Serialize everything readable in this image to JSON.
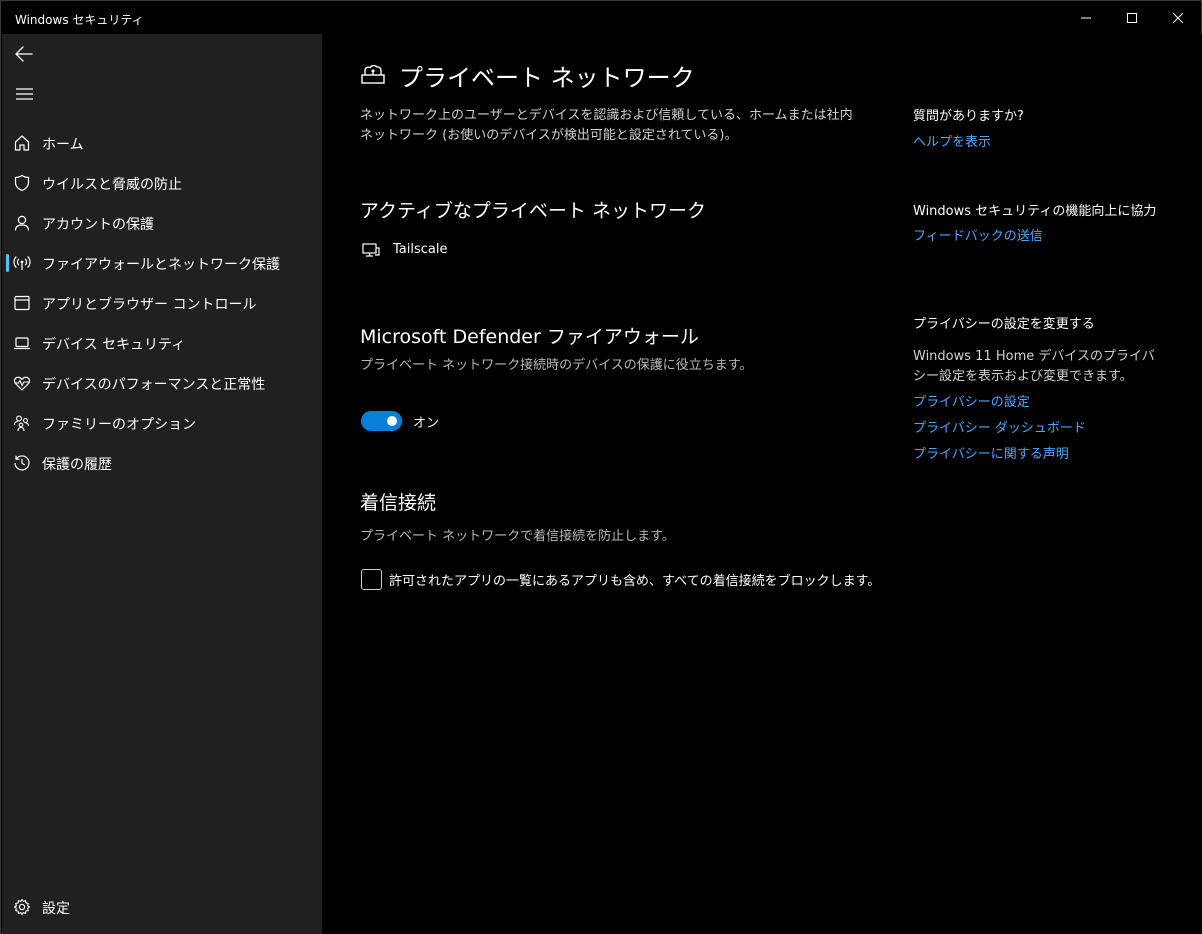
{
  "window": {
    "title": "Windows セキュリティ"
  },
  "sidebar": {
    "items": [
      {
        "label": "ホーム",
        "icon": "home-icon"
      },
      {
        "label": "ウイルスと脅威の防止",
        "icon": "shield-icon"
      },
      {
        "label": "アカウントの保護",
        "icon": "person-icon"
      },
      {
        "label": "ファイアウォールとネットワーク保護",
        "icon": "antenna-icon",
        "active": true
      },
      {
        "label": "アプリとブラウザー コントロール",
        "icon": "app-window-icon"
      },
      {
        "label": "デバイス セキュリティ",
        "icon": "laptop-icon"
      },
      {
        "label": "デバイスのパフォーマンスと正常性",
        "icon": "heart-pulse-icon"
      },
      {
        "label": "ファミリーのオプション",
        "icon": "family-icon"
      },
      {
        "label": "保護の履歴",
        "icon": "history-icon"
      }
    ],
    "settings_label": "設定"
  },
  "main": {
    "title": "プライベート ネットワーク",
    "description": "ネットワーク上のユーザーとデバイスを認識および信頼している、ホームまたは社内ネットワーク (お使いのデバイスが検出可能と設定されている)。",
    "active_networks": {
      "title": "アクティブなプライベート ネットワーク",
      "network_name": "Tailscale"
    },
    "firewall": {
      "title": "Microsoft Defender ファイアウォール",
      "subtitle": "プライベート ネットワーク接続時のデバイスの保護に役立ちます。",
      "toggle_state": "オン",
      "toggle_on": true
    },
    "incoming": {
      "title": "着信接続",
      "subtitle": "プライベート ネットワークで着信接続を防止します。",
      "checkbox_label": "許可されたアプリの一覧にあるアプリも含め、すべての着信接続をブロックします。",
      "checked": false
    }
  },
  "right": {
    "help": {
      "heading": "質問がありますか?",
      "link": "ヘルプを表示"
    },
    "feedback": {
      "heading": "Windows セキュリティの機能向上に協力",
      "link": "フィードバックの送信"
    },
    "privacy": {
      "heading": "プライバシーの設定を変更する",
      "text": "Windows 11 Home デバイスのプライバシー設定を表示および変更できます。",
      "links": [
        "プライバシーの設定",
        "プライバシー ダッシュボード",
        "プライバシーに関する声明"
      ]
    }
  },
  "colors": {
    "accent": "#0a7fd9",
    "link": "#4aa6ff",
    "sidebar_bg": "#202020",
    "main_bg": "#000000"
  }
}
